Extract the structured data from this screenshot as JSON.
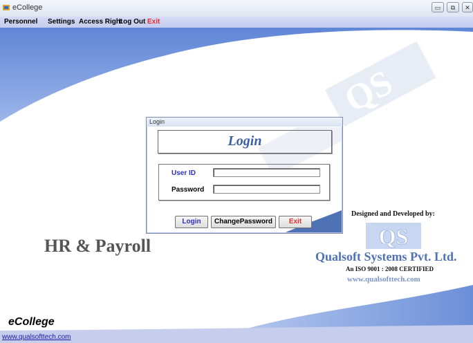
{
  "window": {
    "title": "eCollege"
  },
  "menu": {
    "items": [
      "Personnel",
      "Settings",
      "Access Right",
      "Log Out"
    ],
    "exit": "Exit"
  },
  "login_dialog": {
    "title": "Login",
    "heading": "Login",
    "user_id_label": "User ID",
    "user_id_value": "",
    "password_label": "Password",
    "password_value": "",
    "buttons": {
      "login": "Login",
      "change_password": "ChangePassword",
      "exit": "Exit"
    }
  },
  "branding": {
    "product": "HR & Payroll",
    "designed_by": "Designed and Developed by:",
    "logo_text": "QS",
    "company": "Qualsoft Systems Pvt. Ltd.",
    "certification": "An ISO 9001 : 2008 CERTIFIED",
    "website": "www.qualsofttech.com",
    "app_name": "eCollege"
  },
  "statusbar": {
    "link": "www.qualsofttech.com"
  },
  "colors": {
    "accent_blue": "#4e72b3",
    "menu_bg": "#c7cdec",
    "exit_red": "#e32b2b"
  }
}
